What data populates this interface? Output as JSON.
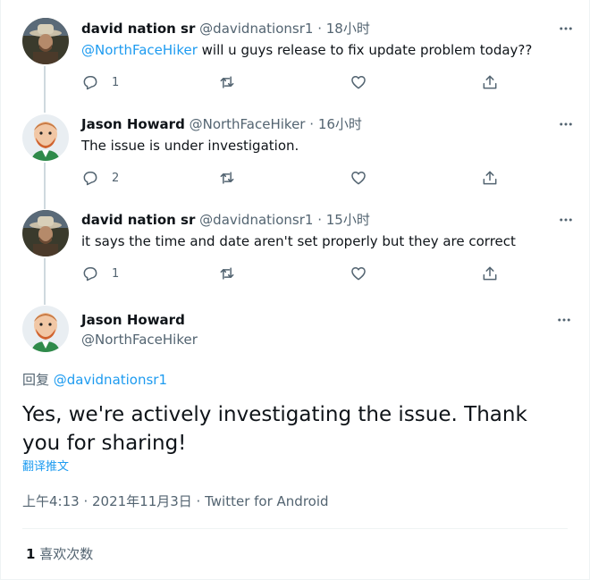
{
  "colors": {
    "accent": "#1d9bf0",
    "muted": "#536471",
    "text": "#0f1419",
    "thread_line": "#cfd9de"
  },
  "replies": [
    {
      "name": "david nation sr",
      "handle": "@davidnationsr1",
      "separator": "·",
      "time": "18小时",
      "mention": "@NorthFaceHiker",
      "text": " will u guys release to fix update problem today??",
      "reply_count": "1"
    },
    {
      "name": "Jason Howard",
      "handle": "@NorthFaceHiker",
      "separator": "·",
      "time": "16小时",
      "mention": "",
      "text": "The issue is under investigation.",
      "reply_count": "2"
    },
    {
      "name": "david nation sr",
      "handle": "@davidnationsr1",
      "separator": "·",
      "time": "15小时",
      "mention": "",
      "text": "it says the time and date aren't set properly but they are correct",
      "reply_count": "1"
    }
  ],
  "main_tweet": {
    "name": "Jason Howard",
    "handle": "@NorthFaceHiker",
    "reply_prefix": "回复 ",
    "reply_to": "@davidnationsr1",
    "text": "Yes, we're actively investigating the issue.  Thank you for sharing!",
    "translate_label": "翻译推文",
    "timestamp": "上午4:13 · 2021年11月3日 · Twitter for Android",
    "like_count": "1",
    "like_label": " 喜欢次数"
  },
  "icons": {
    "more": "more-horizontal-icon",
    "reply": "reply-bubble-icon",
    "retweet": "retweet-icon",
    "like": "heart-icon",
    "share": "share-upload-icon"
  }
}
